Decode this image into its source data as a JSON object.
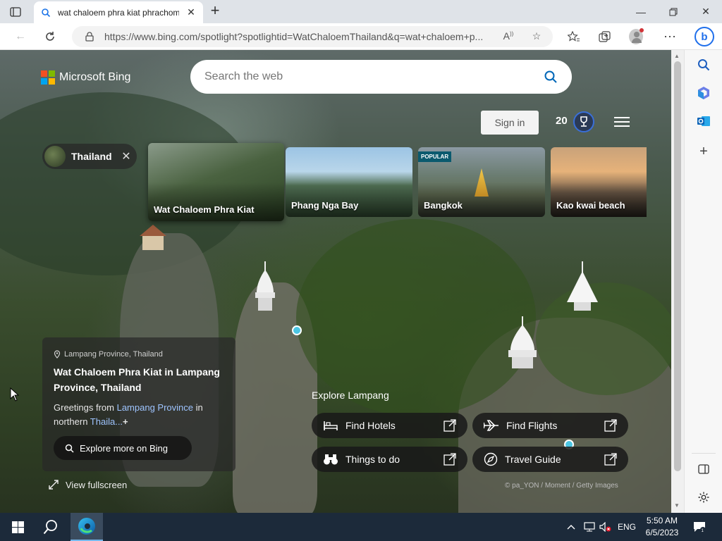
{
  "browser": {
    "tab_title": "wat chaloem phra kiat phrachom",
    "url": "https://www.bing.com/spotlight?spotlightid=WatChaloemThailand&q=wat+chaloem+p..."
  },
  "bing": {
    "logo_text": "Microsoft Bing",
    "search_placeholder": "Search the web",
    "sign_in": "Sign in",
    "rewards_points": "20"
  },
  "chip": {
    "label": "Thailand"
  },
  "cards": [
    {
      "caption": "Wat Chaloem Phra Kiat",
      "badge": ""
    },
    {
      "caption": "Phang Nga Bay",
      "badge": ""
    },
    {
      "caption": "Bangkok",
      "badge": "POPULAR"
    },
    {
      "caption": "Kao kwai beach",
      "badge": ""
    }
  ],
  "info": {
    "location": "Lampang Province, Thailand",
    "title": "Wat Chaloem Phra Kiat in Lampang Province, Thailand",
    "desc_prefix": "Greetings from ",
    "desc_link1": "Lampang Province",
    "desc_mid": " in northern ",
    "desc_link2": "Thaila...",
    "desc_more": "+",
    "explore_button": "Explore more on Bing",
    "fullscreen": "View fullscreen"
  },
  "explore": {
    "title": "Explore Lampang",
    "buttons": [
      {
        "label": "Find Hotels",
        "icon": "bed-icon"
      },
      {
        "label": "Find Flights",
        "icon": "plane-icon"
      },
      {
        "label": "Things to do",
        "icon": "binoculars-icon"
      },
      {
        "label": "Travel Guide",
        "icon": "compass-icon"
      }
    ],
    "credit": "© pa_YON / Moment / Getty Images"
  },
  "taskbar": {
    "language": "ENG",
    "time": "5:50 AM",
    "date": "6/5/2023"
  },
  "colors": {
    "accent_blue": "#0067b8",
    "link_blue": "#9ec4ff",
    "taskbar": "#1c2a3a",
    "popular_badge": "#0b5a6e"
  }
}
